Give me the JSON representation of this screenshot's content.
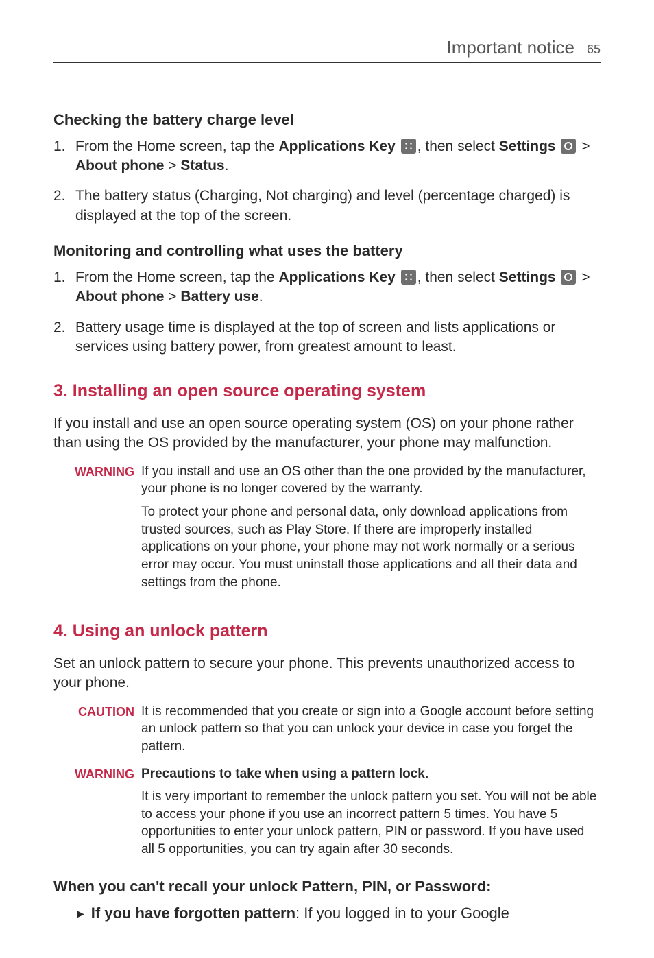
{
  "header": {
    "section": "Important notice",
    "page": "65"
  },
  "checkSection": {
    "heading": "Checking the battery charge level",
    "items": [
      {
        "num": "1.",
        "pre": "From the Home screen, tap the ",
        "apps_key": "Applications Key",
        "mid": ", then select ",
        "settings_label": "Settings",
        "path_sep1": " > ",
        "about_phone": "About phone",
        "path_sep2": " > ",
        "last": "Status",
        "period": "."
      },
      {
        "num": "2.",
        "text": "The battery status (Charging, Not charging) and level (percentage charged) is displayed at the top of the screen."
      }
    ]
  },
  "monitorSection": {
    "heading": "Monitoring and controlling what uses the battery",
    "items": [
      {
        "num": "1.",
        "pre": "From the Home screen, tap the ",
        "apps_key": "Applications Key",
        "mid": ", then select ",
        "settings_label": "Settings",
        "path_sep1": " > ",
        "about_phone": "About phone",
        "path_sep2": " > ",
        "last": "Battery use",
        "period": "."
      },
      {
        "num": "2.",
        "text": "Battery usage time is displayed at the top of screen and lists applications or services using battery power, from greatest amount to least."
      }
    ]
  },
  "section3": {
    "heading": "3. Installing an open source operating system",
    "intro": "If you install and use an open source operating system (OS) on your phone rather than using the OS provided by the manufacturer, your phone may malfunction.",
    "warning_label": "WARNING",
    "warning_p1": "If you install and use an OS other than the one provided by the manufacturer, your phone is no longer covered by the warranty.",
    "warning_p2": "To protect your phone and personal data, only download applications from trusted sources, such as Play Store. If there are improperly installed applications on your phone, your phone may not work normally or a serious error may occur. You must uninstall those applications and all their data and settings from the phone."
  },
  "section4": {
    "heading": "4. Using an unlock pattern",
    "intro": "Set an unlock pattern to secure your phone. This prevents unauthorized access to your phone.",
    "caution_label": "CAUTION",
    "caution_text": "It is recommended that you create or sign into a Google account before setting an unlock pattern so that you can unlock your device in case you forget the pattern.",
    "warning_label": "WARNING",
    "warning_bold": "Precautions to take when using a pattern lock.",
    "warning_text": "It is very important to remember the unlock pattern you set. You will not be able to access your phone if you use an incorrect pattern 5 times. You have 5 opportunities to enter your unlock pattern, PIN or password. If you have used all 5 opportunities, you can try again after 30 seconds.",
    "recall_heading": "When you can't recall your unlock Pattern, PIN, or Password:",
    "bullet_bold": "If you have forgotten pattern",
    "bullet_rest": ": If you logged in to your Google"
  }
}
